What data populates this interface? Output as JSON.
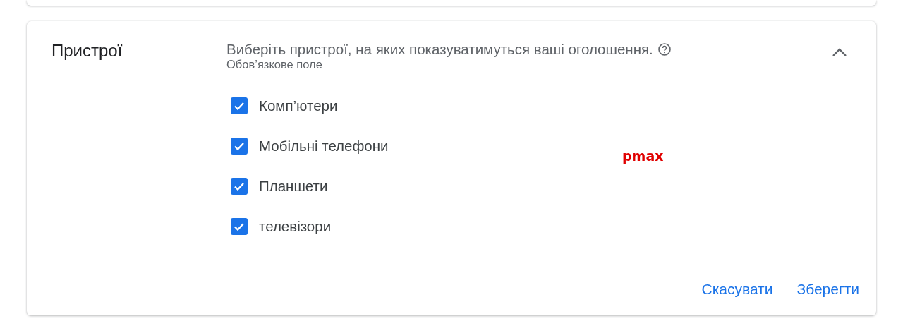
{
  "section": {
    "title": "Пристрої",
    "description": "Виберіть пристрої, на яких показуватимуться ваші оголошення.",
    "required_note": "Обов’язкове поле",
    "expanded": true
  },
  "devices": [
    {
      "label": "Комп’ютери",
      "checked": true
    },
    {
      "label": "Мобільні телефони",
      "checked": true
    },
    {
      "label": "Планшети",
      "checked": true
    },
    {
      "label": "телевізори",
      "checked": true
    }
  ],
  "annotation": "pmax",
  "buttons": [
    {
      "label": "Скасувати"
    },
    {
      "label": "Зберегти"
    }
  ]
}
